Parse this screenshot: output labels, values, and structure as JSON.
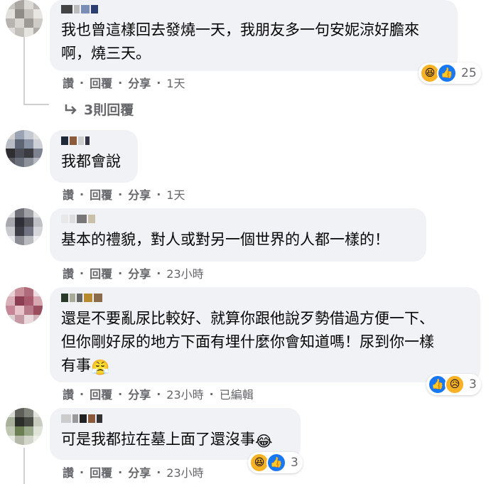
{
  "comments": [
    {
      "text": "我也曾這樣回去發燒一天，我朋友多一句安妮涼好膽來\n啊，燒三天。",
      "actions": {
        "like": "讚",
        "reply": "回覆",
        "share": "分享",
        "time": "1天"
      },
      "reaction_count": "25",
      "reactions": [
        "haha-icon",
        "like-icon"
      ],
      "replies_label": "3則回覆"
    },
    {
      "text": "我都會說",
      "actions": {
        "like": "讚",
        "reply": "回覆",
        "share": "分享",
        "time": "1天"
      }
    },
    {
      "text": "基本的禮貌，對人或對另一個世界的人都一樣的！",
      "actions": {
        "like": "讚",
        "reply": "回覆",
        "share": "分享",
        "time": "23小時"
      }
    },
    {
      "text": "還是不要亂尿比較好、就算你跟他說歹勢借過方便一下、\n但你剛好尿的地方下面有埋什麼你會知道嗎！尿到你一樣\n有事",
      "emoji": "😤",
      "actions": {
        "like": "讚",
        "reply": "回覆",
        "share": "分享",
        "time": "23小時",
        "edited": "已編輯"
      },
      "reaction_count": "3",
      "reactions": [
        "like-icon",
        "sad-icon"
      ]
    },
    {
      "text": "可是我都拉在墓上面了還沒事",
      "emoji": "😂",
      "actions": {
        "like": "讚",
        "reply": "回覆",
        "share": "分享",
        "time": "23小時"
      },
      "reaction_count": "3",
      "reactions": [
        "haha-icon",
        "like-icon"
      ]
    }
  ],
  "separator": "·",
  "colors": {
    "bubble": "#f0f2f5",
    "meta": "#65676b",
    "like": "#1877f2",
    "haha": "#f7b125"
  }
}
